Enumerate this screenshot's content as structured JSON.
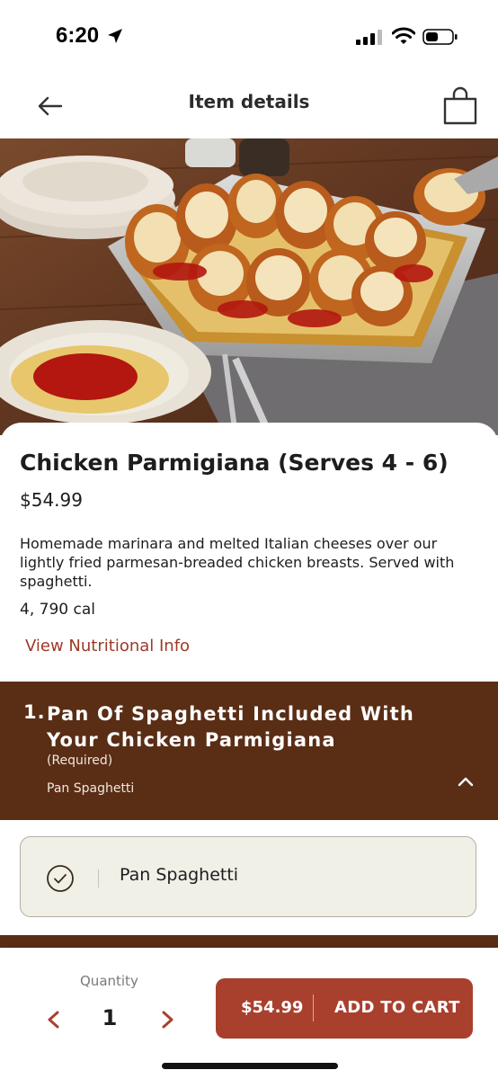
{
  "status_bar": {
    "time": "6:20",
    "icons": [
      "location-arrow-icon",
      "cellular-signal-icon",
      "wifi-icon",
      "battery-icon"
    ]
  },
  "header": {
    "title": "Item details",
    "back_icon": "arrow-left-icon",
    "bag_icon": "shopping-bag-icon"
  },
  "item": {
    "name": "Chicken Parmigiana (Serves 4 - 6)",
    "price": "$54.99",
    "description": "Homemade marinara and melted Italian cheeses over our lightly fried parmesan-breaded chicken breasts. Served with spaghetti.",
    "calories": "4, 790 cal",
    "nutrition_link": "View Nutritional Info"
  },
  "section": {
    "number": "1.",
    "title": "Pan Of Spaghetti Included With Your Chicken Parmigiana",
    "required": "(Required)",
    "selected": "Pan Spaghetti",
    "toggle_icon": "chevron-up-icon"
  },
  "options": [
    {
      "label": "Pan Spaghetti",
      "selected": true,
      "icon": "check-circle-icon"
    }
  ],
  "bottom_bar": {
    "quantity_label": "Quantity",
    "quantity": "1",
    "cart_price": "$54.99",
    "cart_label": "ADD TO CART"
  },
  "colors": {
    "brand_brown": "#5a2d15",
    "accent_red": "#a8402d",
    "link_red": "#9c3a27",
    "option_bg": "#f1f0e7"
  }
}
